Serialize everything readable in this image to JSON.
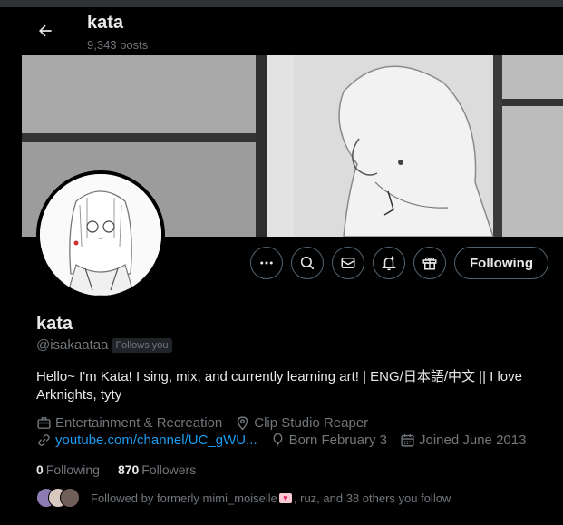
{
  "header": {
    "title": "kata",
    "posts": "9,343 posts"
  },
  "profile": {
    "name": "kata",
    "handle": "@isakaataa",
    "follows_you": "Follows you",
    "bio": "Hello~ I'm Kata! I sing, mix, and currently learning art! | ENG/日本語/中文 || I love Arknights, tyty",
    "category": "Entertainment & Recreation",
    "location": "Clip Studio Reaper",
    "website": "youtube.com/channel/UC_gWU...",
    "birthday": "Born February 3",
    "joined": "Joined June 2013",
    "following_count": "0",
    "following_label": "Following",
    "followers_count": "870",
    "followers_label": "Followers",
    "followed_by_prefix": "Followed by formerly mimi_moiselle",
    "followed_by_suffix": ", ruz, and 38 others you follow"
  },
  "actions": {
    "follow_label": "Following"
  },
  "colors": {
    "background": "#000000",
    "text_primary": "#e7e9ea",
    "text_secondary": "#71767b",
    "link": "#1d9bf0",
    "border": "#536471"
  }
}
